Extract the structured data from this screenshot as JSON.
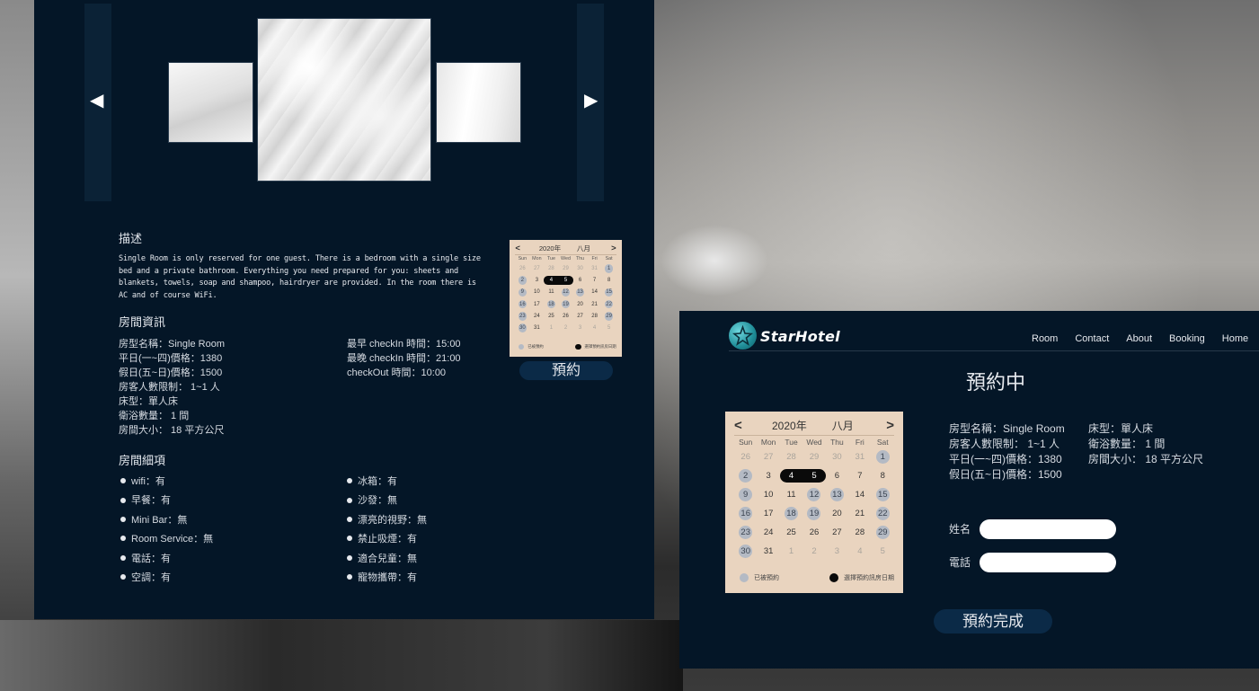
{
  "room_page": {
    "description_heading": "描述",
    "description_text": "Single Room is only reserved for one guest. There is a bedroom with a single size bed and a private bathroom. Everything you need prepared for you: sheets and blankets, towels, soap and shampoo, hairdryer are provided. In the room there is AC and of course WiFi.",
    "info_heading": "房間資訊",
    "info_left": [
      "房型名稱：Single Room",
      "平日(一~四)價格：1380",
      "假日(五~日)價格：1500",
      "房客人數限制： 1~1 人",
      "床型：單人床",
      "衛浴數量： 1 間",
      "房間大小： 18 平方公尺"
    ],
    "info_right": [
      "最早 checkIn 時間：15:00",
      "最晚 checkIn 時間：21:00",
      "checkOut 時間：10:00"
    ],
    "details_heading": "房間細項",
    "features_left": [
      "wifi：有",
      "早餐：有",
      "Mini Bar：無",
      "Room Service：無",
      "電話：有",
      "空調：有"
    ],
    "features_right": [
      "冰箱：有",
      "沙發：無",
      "漂亮的視野：無",
      "禁止吸煙：有",
      "適合兒童：無",
      "寵物攜帶：有"
    ],
    "book_button": "預約",
    "carousel_prev": "◀",
    "carousel_next": "▶"
  },
  "calendar": {
    "prev": "<",
    "next": ">",
    "year": "2020年",
    "month": "八月",
    "weekdays": [
      "Sun",
      "Mon",
      "Tue",
      "Wed",
      "Thu",
      "Fri",
      "Sat"
    ],
    "weeks": [
      [
        "26",
        "27",
        "28",
        "29",
        "30",
        "31",
        "1"
      ],
      [
        "2",
        "3",
        "4",
        "5",
        "6",
        "7",
        "8"
      ],
      [
        "9",
        "10",
        "11",
        "12",
        "13",
        "14",
        "15"
      ],
      [
        "16",
        "17",
        "18",
        "19",
        "20",
        "21",
        "22"
      ],
      [
        "23",
        "24",
        "25",
        "26",
        "27",
        "28",
        "29"
      ],
      [
        "30",
        "31",
        "1",
        "2",
        "3",
        "4",
        "5"
      ]
    ],
    "booked": [
      "0-6",
      "1-0",
      "2-0",
      "2-3",
      "2-4",
      "2-6",
      "3-0",
      "3-2",
      "3-3",
      "3-6",
      "4-0",
      "4-6",
      "5-0"
    ],
    "selected": [
      "1-2",
      "1-3"
    ],
    "other_month": [
      "0-0",
      "0-1",
      "0-2",
      "0-3",
      "0-4",
      "0-5",
      "5-2",
      "5-3",
      "5-4",
      "5-5",
      "5-6"
    ],
    "legend_booked": "已被預約",
    "legend_selected": "選擇預約訊房日期",
    "colors": {
      "background": "#e9d4bf",
      "booked": "#b4bac4",
      "selected": "#0a0a0a"
    }
  },
  "booking_modal": {
    "brand": "StarHotel",
    "nav": [
      "Room",
      "Contact",
      "About",
      "Booking",
      "Home"
    ],
    "title": "預約中",
    "info_left": [
      "房型名稱：Single Room",
      "房客人數限制： 1~1 人",
      "平日(一~四)價格：1380",
      "假日(五~日)價格：1500"
    ],
    "info_right": [
      "床型：單人床",
      "衛浴數量： 1 間",
      "房間大小： 18 平方公尺"
    ],
    "name_label": "姓名",
    "phone_label": "電話",
    "name_value": "",
    "phone_value": "",
    "submit_button": "預約完成"
  },
  "colors": {
    "panel": "#041627",
    "button": "#0b2a47",
    "text": "#dfe4ea"
  }
}
